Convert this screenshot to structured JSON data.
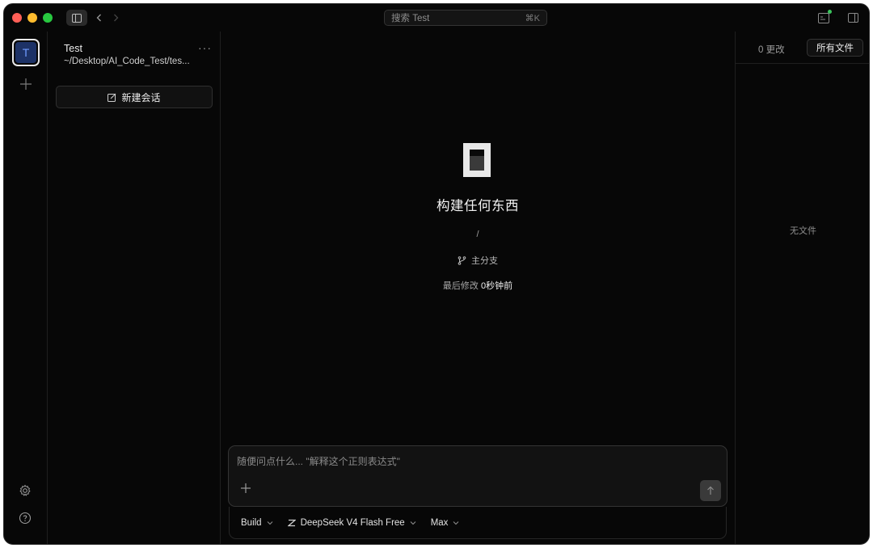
{
  "titlebar": {
    "search_placeholder": "搜索 Test",
    "search_shortcut": "⌘K"
  },
  "rail": {
    "project_initial": "T"
  },
  "session_panel": {
    "project_name": "Test",
    "project_path": "~/Desktop/AI_Code_Test/tes...",
    "more_label": "···",
    "new_session_label": "新建会话"
  },
  "main": {
    "title": "构建任何东西",
    "path": "/",
    "branch": "主分支",
    "modified_label": "最后修改",
    "modified_value": "0秒钟前",
    "composer": {
      "placeholder": "随便问点什么... \"解释这个正则表达式\""
    },
    "toolbar": {
      "agent": "Build",
      "model": "DeepSeek V4 Flash Free",
      "mode": "Max"
    }
  },
  "right_panel": {
    "changes_tab": "0 更改",
    "all_files_tab": "所有文件",
    "empty_text": "无文件"
  },
  "colors": {
    "window_bg": "#070707",
    "accent_blue": "#1d3266",
    "status_green": "#3ac45c"
  },
  "icons": [
    "sidebar-toggle-icon",
    "chevron-left-icon",
    "chevron-right-icon",
    "terminal-icon",
    "right-panel-icon",
    "plus-icon",
    "gear-icon",
    "help-icon",
    "edit-icon",
    "branch-icon",
    "arrow-up-icon",
    "chevron-down-icon",
    "model-logo-icon"
  ]
}
